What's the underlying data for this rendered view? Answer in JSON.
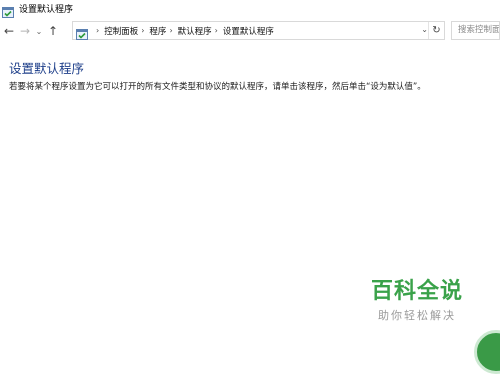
{
  "window": {
    "title": "设置默认程序"
  },
  "nav": {
    "back_icon": "←",
    "forward_icon": "→",
    "recent_icon": "⌄",
    "up_icon": "↑"
  },
  "address": {
    "sep": "›",
    "crumbs": [
      "控制面板",
      "程序",
      "默认程序",
      "设置默认程序"
    ],
    "dropdown_icon": "⌄",
    "refresh_icon": "↻"
  },
  "search": {
    "placeholder": "搜索控制面"
  },
  "main": {
    "title": "设置默认程序",
    "description": "若要将某个程序设置为它可以打开的所有文件类型和协议的默认程序，请单击该程序，然后单击“设为默认值”。"
  },
  "watermark": {
    "main": "百科全说",
    "sub": "助你轻松解决"
  },
  "colors": {
    "title_blue": "#1e3f8a",
    "watermark_green": "#3aa24a"
  }
}
